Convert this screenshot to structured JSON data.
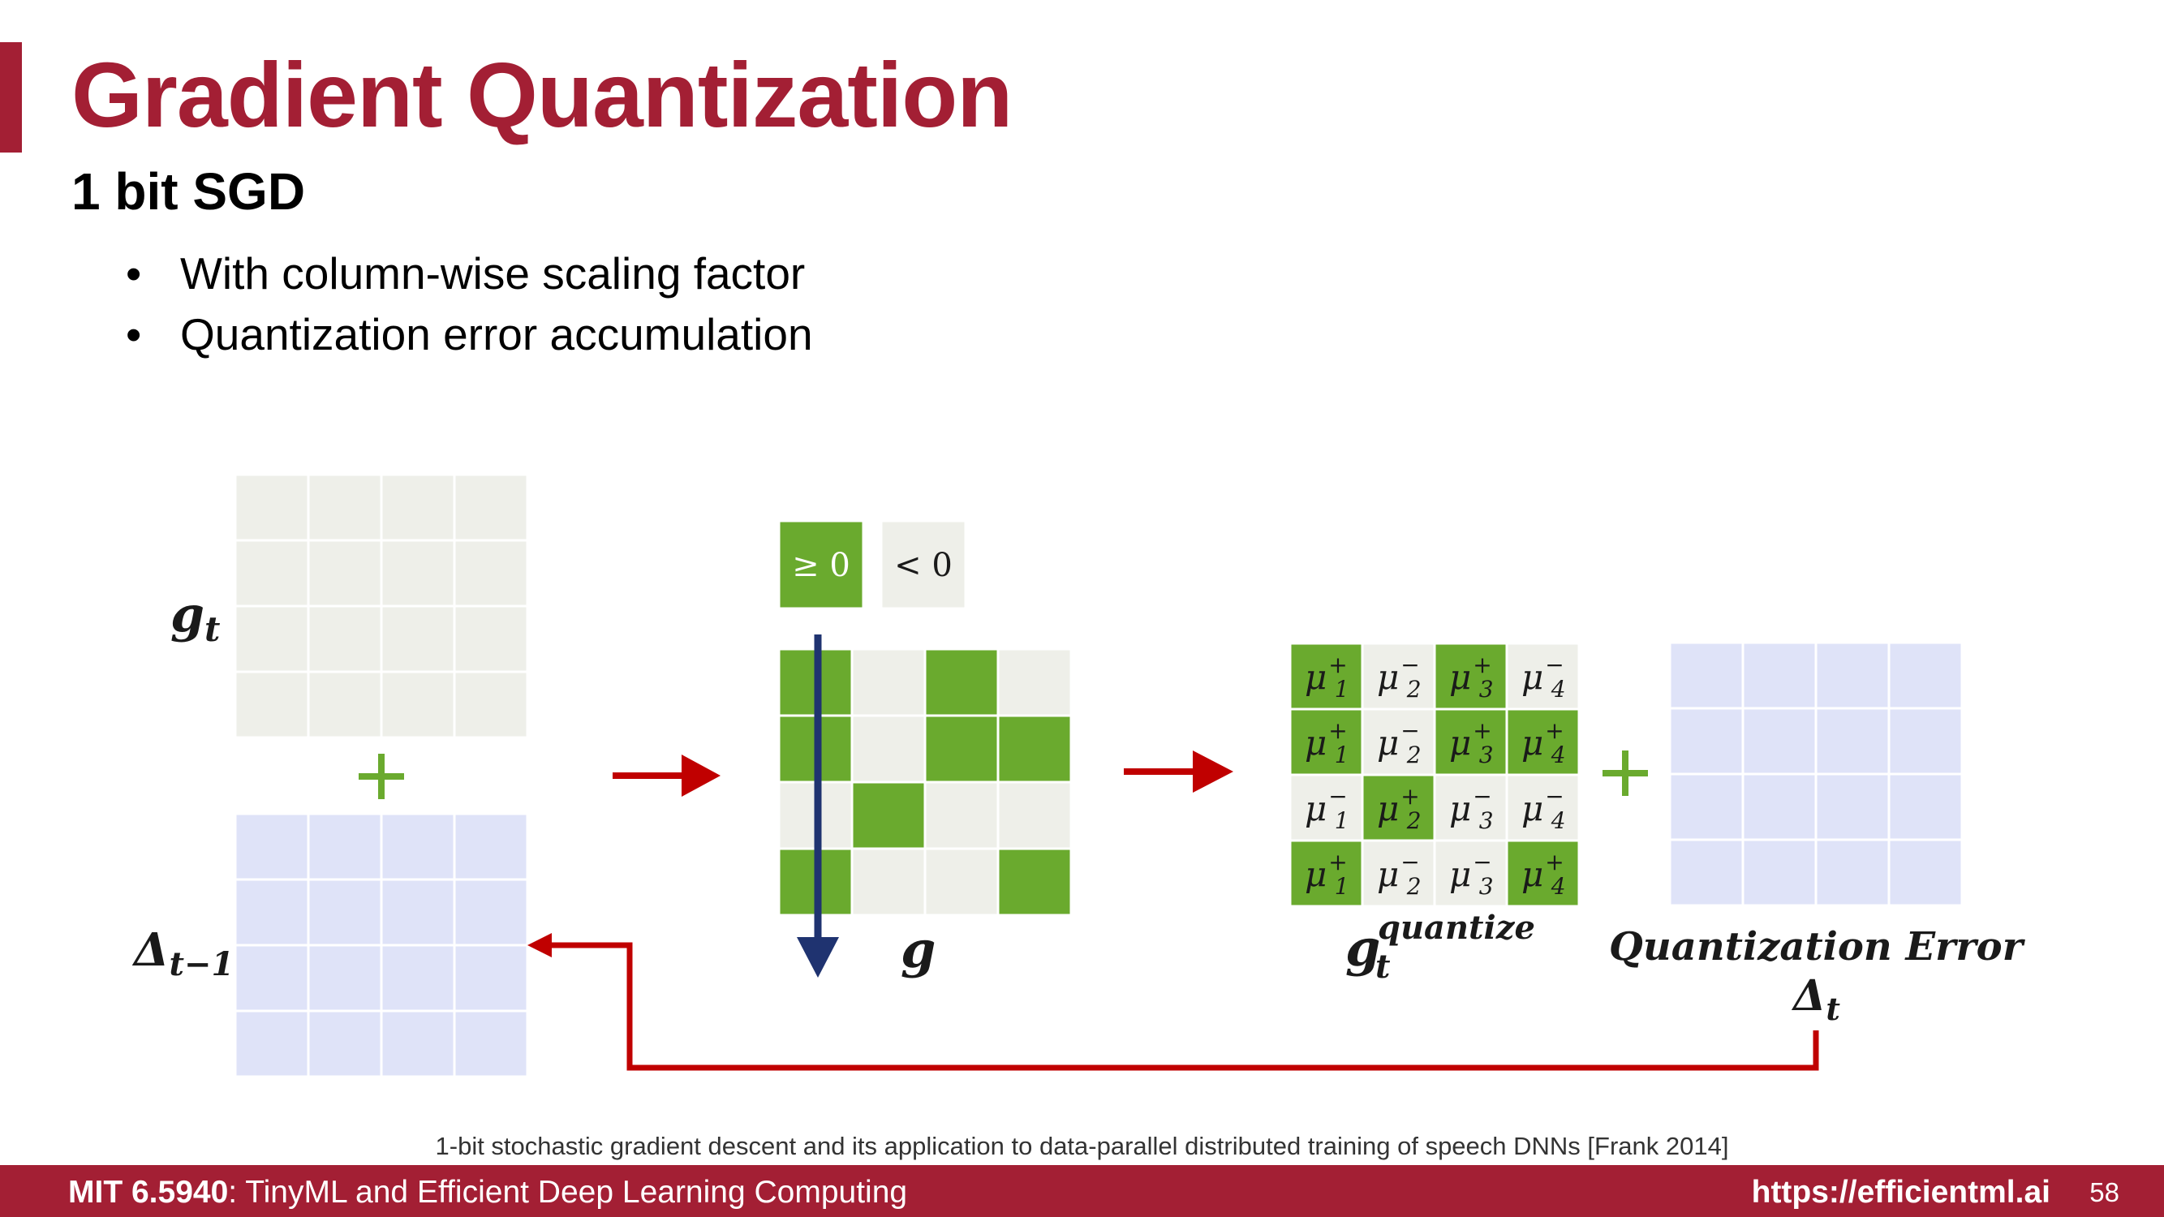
{
  "slide": {
    "title": "Gradient Quantization",
    "subtitle": "1 bit SGD",
    "bullets": [
      "With column-wise scaling factor",
      "Quantization error accumulation"
    ]
  },
  "diagram": {
    "colors": {
      "accent": "#a31f34",
      "green": "#6aaa2e",
      "light_cell": "#eeefe9",
      "blue_cell": "#dfe3f8",
      "arrow_red": "#c00000",
      "arrow_navy": "#1f3370"
    },
    "legend": {
      "nonneg": "≥ 0",
      "neg": "< 0"
    },
    "labels": {
      "g_t": "g",
      "g_t_sub": "t",
      "delta_prev": "Δ",
      "delta_prev_sub": "t−1",
      "g": "g",
      "gq": "g",
      "gq_sub": "t",
      "gq_sup": "quantize",
      "qerror_title": "Quantization Error",
      "qerror_delta": "Δ",
      "qerror_sub": "t"
    },
    "sign_matrix": [
      [
        1,
        0,
        1,
        0
      ],
      [
        1,
        0,
        1,
        1
      ],
      [
        0,
        1,
        0,
        0
      ],
      [
        1,
        0,
        0,
        1
      ]
    ],
    "quantized_matrix": [
      [
        {
          "sign": "+",
          "i": "1"
        },
        {
          "sign": "−",
          "i": "2"
        },
        {
          "sign": "+",
          "i": "3"
        },
        {
          "sign": "−",
          "i": "4"
        }
      ],
      [
        {
          "sign": "+",
          "i": "1"
        },
        {
          "sign": "−",
          "i": "2"
        },
        {
          "sign": "+",
          "i": "3"
        },
        {
          "sign": "+",
          "i": "4"
        }
      ],
      [
        {
          "sign": "−",
          "i": "1"
        },
        {
          "sign": "+",
          "i": "2"
        },
        {
          "sign": "−",
          "i": "3"
        },
        {
          "sign": "−",
          "i": "4"
        }
      ],
      [
        {
          "sign": "+",
          "i": "1"
        },
        {
          "sign": "−",
          "i": "2"
        },
        {
          "sign": "−",
          "i": "3"
        },
        {
          "sign": "+",
          "i": "4"
        }
      ]
    ]
  },
  "citation": "1-bit stochastic gradient descent and its application to data-parallel distributed training of speech DNNs [Frank 2014]",
  "footer": {
    "course_code": "MIT 6.5940",
    "course_name": ": TinyML and Efficient Deep Learning Computing",
    "url": "https://efficientml.ai",
    "page": "58"
  }
}
